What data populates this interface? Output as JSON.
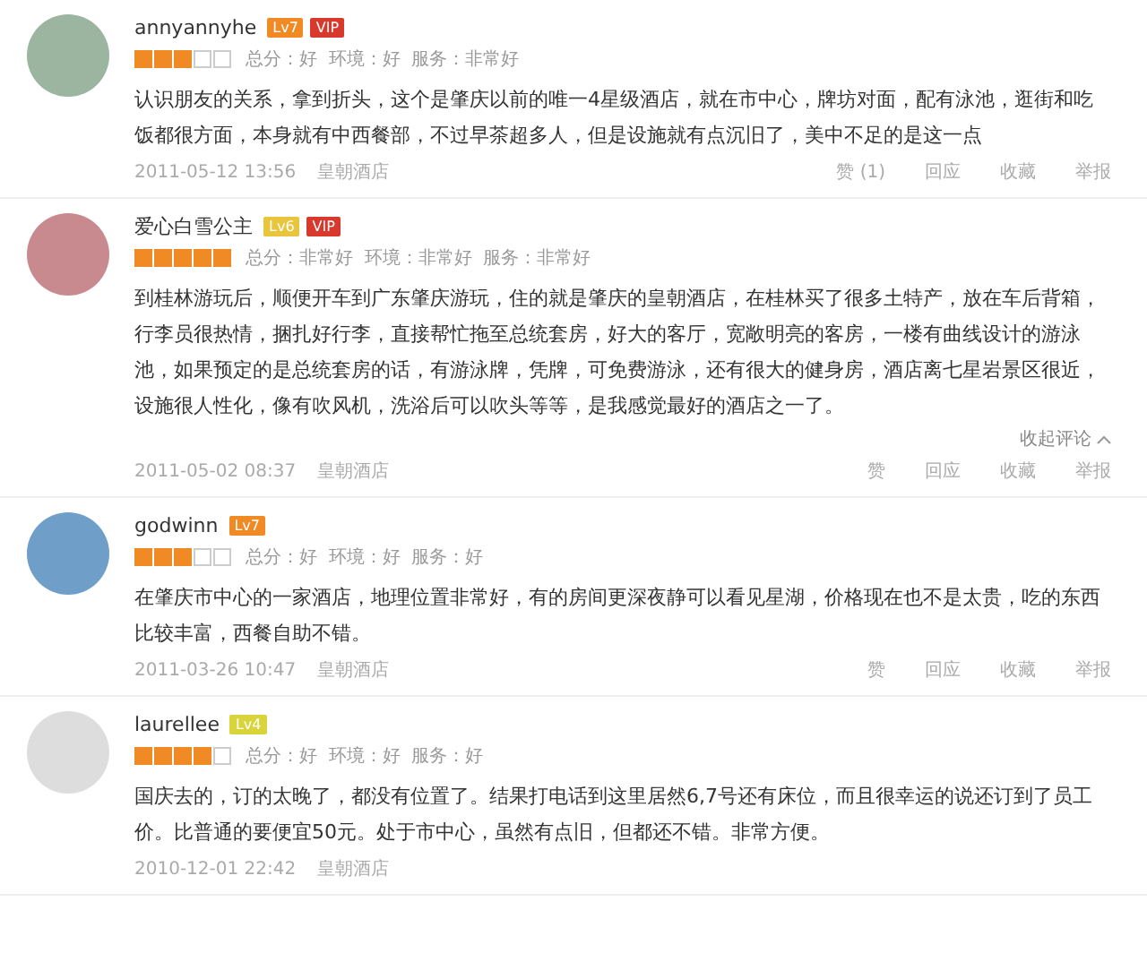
{
  "reviews": [
    {
      "user": "annyannyhe",
      "level_badge": "Lv7",
      "color": "#f08a24",
      "vip": "VIP",
      "stars": 3,
      "ratings": "总分：好  环境：好  服务：非常好",
      "text": "认识朋友的关系，拿到折头，这个是肇庆以前的唯一4星级酒店，就在市中心，牌坊对面，配有泳池，逛街和吃饭都很方面，本身就有中西餐部，不过早茶超多人，但是设施就有点沉旧了，美中不足的是这一点",
      "date": "2011-05-12 13:56",
      "hotel": "皇朝酒店",
      "actions": [
        "赞 (1)",
        "回应",
        "收藏",
        "举报"
      ]
    },
    {
      "user": "爱心白雪公主",
      "level_badge": "Lv6",
      "color": "#e8c53a",
      "vip": "VIP",
      "stars": 5,
      "ratings": "总分：非常好  环境：非常好  服务：非常好",
      "text": "到桂林游玩后，顺便开车到广东肇庆游玩，住的就是肇庆的皇朝酒店，在桂林买了很多土特产，放在车后背箱，行李员很热情，捆扎好行李，直接帮忙拖至总统套房，好大的客厅，宽敞明亮的客房，一楼有曲线设计的游泳池，如果预定的是总统套房的话，有游泳牌，凭牌，可免费游泳，还有很大的健身房，酒店离七星岩景区很近，设施很人性化，像有吹风机，洗浴后可以吹头等等，是我感觉最好的酒店之一了。",
      "collapse": "收起评论",
      "date": "2011-05-02 08:37",
      "hotel": "皇朝酒店",
      "actions": [
        "赞",
        "回应",
        "收藏",
        "举报"
      ]
    },
    {
      "user": "godwinn",
      "level_badge": "Lv7",
      "color": "#f08a24",
      "stars": 3,
      "ratings": "总分：好  环境：好  服务：好",
      "text": "在肇庆市中心的一家酒店，地理位置非常好，有的房间更深夜静可以看见星湖，价格现在也不是太贵，吃的东西比较丰富，西餐自助不错。",
      "date": "2011-03-26 10:47",
      "hotel": "皇朝酒店",
      "actions": [
        "赞",
        "回应",
        "收藏",
        "举报"
      ]
    },
    {
      "user": "laurellee",
      "level_badge": "Lv4",
      "color": "#d8d43a",
      "stars": 4,
      "ratings": "总分：好  环境：好  服务：好",
      "text": "国庆去的，订的太晚了，都没有位置了。结果打电话到这里居然6,7号还有床位，而且很幸运的说还订到了员工价。比普通的要便宜50元。处于市中心，虽然有点旧，但都还不错。非常方便。",
      "date": "2010-12-01 22:42",
      "hotel": "皇朝酒店"
    }
  ]
}
